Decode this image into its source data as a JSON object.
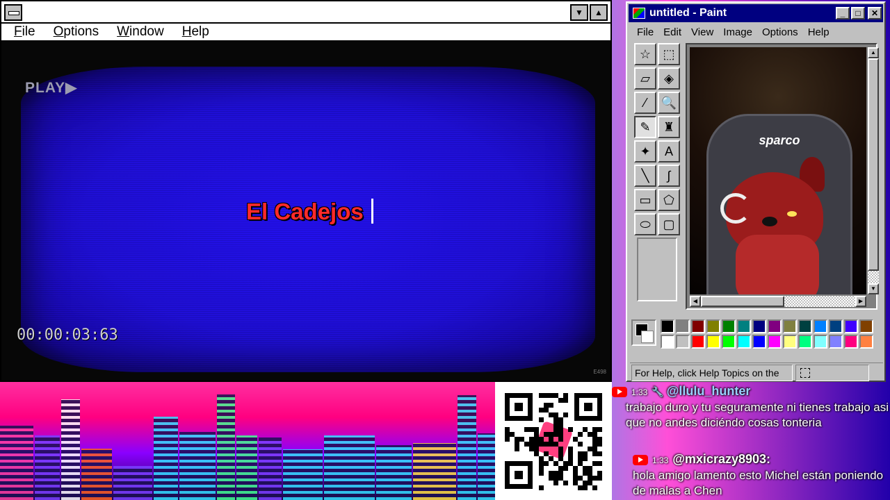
{
  "player": {
    "title": "",
    "menu": [
      "File",
      "Options",
      "Window",
      "Help"
    ],
    "minimize_glyph": "▼",
    "maximize_glyph": "▲",
    "video": {
      "play_label": "PLAY▶",
      "title_text": "El Cadejos",
      "timecode": "00:00:03:63",
      "corner_mark": "E498"
    }
  },
  "paint": {
    "title": "untitled - Paint",
    "menu": [
      "File",
      "Edit",
      "View",
      "Image",
      "Options",
      "Help"
    ],
    "window_buttons": {
      "minimize": "_",
      "maximize": "□",
      "close": "✕"
    },
    "tools": [
      {
        "name": "free-select-icon",
        "glyph": "☆"
      },
      {
        "name": "rect-select-icon",
        "glyph": "⬚"
      },
      {
        "name": "eraser-icon",
        "glyph": "▱"
      },
      {
        "name": "fill-bucket-icon",
        "glyph": "◈"
      },
      {
        "name": "eyedropper-icon",
        "glyph": "⁄"
      },
      {
        "name": "magnifier-icon",
        "glyph": "🔍"
      },
      {
        "name": "pencil-icon",
        "glyph": "✎"
      },
      {
        "name": "brush-icon",
        "glyph": "♜"
      },
      {
        "name": "airbrush-icon",
        "glyph": "✦"
      },
      {
        "name": "text-icon",
        "glyph": "A"
      },
      {
        "name": "line-icon",
        "glyph": "╲"
      },
      {
        "name": "curve-icon",
        "glyph": "∫"
      },
      {
        "name": "rectangle-icon",
        "glyph": "▭"
      },
      {
        "name": "polygon-icon",
        "glyph": "⬠"
      },
      {
        "name": "ellipse-icon",
        "glyph": "⬭"
      },
      {
        "name": "rounded-rect-icon",
        "glyph": "▢"
      }
    ],
    "active_tool": "pencil-icon",
    "canvas_label": "sparco",
    "palette_top": [
      "#000000",
      "#808080",
      "#800000",
      "#808000",
      "#008000",
      "#008080",
      "#000080",
      "#800080",
      "#808040",
      "#004040",
      "#0080ff",
      "#004080",
      "#4000ff",
      "#804000"
    ],
    "palette_bottom": [
      "#ffffff",
      "#c0c0c0",
      "#ff0000",
      "#ffff00",
      "#00ff00",
      "#00ffff",
      "#0000ff",
      "#ff00ff",
      "#ffff80",
      "#00ff80",
      "#80ffff",
      "#8080ff",
      "#ff0080",
      "#ff8040"
    ],
    "foreground": "#000000",
    "background": "#ffffff",
    "status": "For Help, click Help Topics on the"
  },
  "chat": [
    {
      "platform": "youtube-icon",
      "time": "1:33",
      "user": "@llulu_hunter",
      "text": "trabajo duro y tu seguramente ni tienes trabajo asi que no andes diciéndo cosas tonteria"
    },
    {
      "platform": "youtube-icon",
      "time": "1:33",
      "user": "@mxicrazy8903:",
      "text": "hola amigo lamento esto Michel están poniendo de malas a Chen"
    }
  ]
}
